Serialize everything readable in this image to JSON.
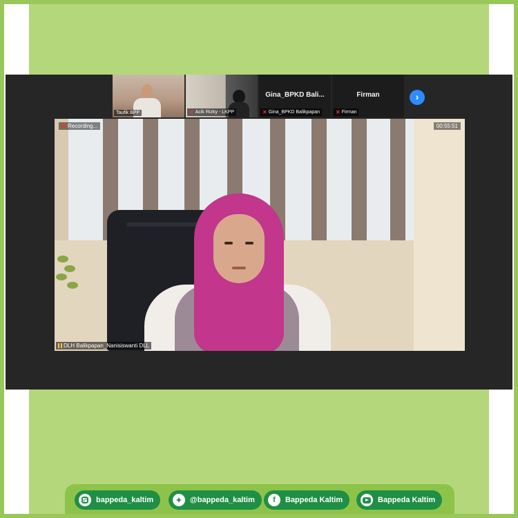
{
  "meeting": {
    "thumbnails": [
      {
        "label": "Taufik BPP",
        "type": "video-man"
      },
      {
        "label": "Acik Rizky - LKPP",
        "type": "video-dark"
      },
      {
        "title": "Gina_BPKD Bali...",
        "label": "Gina_BPKD Balikpapan",
        "type": "name-only"
      },
      {
        "title": "Firman",
        "label": "Firman",
        "type": "name-only"
      }
    ],
    "next_icon": "chevron-right-icon",
    "main_speaker": {
      "recording_label": "Recording...",
      "timer": "00:55:51",
      "name_tag": "DLH Balikpapan_Nanisiswanti DLL"
    }
  },
  "social": {
    "instagram": {
      "icon": "instagram-icon",
      "handle": "bappeda_kaltim"
    },
    "twitter": {
      "icon": "twitter-icon",
      "handle": "@bappeda_kaltim"
    },
    "facebook": {
      "icon": "facebook-icon",
      "handle": "Bappeda Kaltim"
    },
    "youtube": {
      "icon": "youtube-icon",
      "handle": "Bappeda Kaltim"
    }
  },
  "colors": {
    "frame_green": "#b5d77b",
    "border_green": "#9ac75a",
    "pill_green": "#1f8f45",
    "zoom_dark": "#262626",
    "zoom_blue": "#2d8cff",
    "muted_red": "#e53935",
    "hijab_magenta": "#c2368c"
  }
}
